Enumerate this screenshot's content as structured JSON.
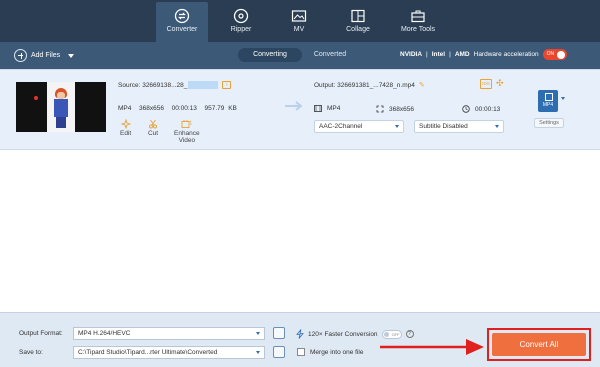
{
  "nav": {
    "items": [
      {
        "label": "Converter",
        "icon": "converter-icon",
        "active": true
      },
      {
        "label": "Ripper",
        "icon": "ripper-icon",
        "active": false
      },
      {
        "label": "MV",
        "icon": "mv-icon",
        "active": false
      },
      {
        "label": "Collage",
        "icon": "collage-icon",
        "active": false
      },
      {
        "label": "More Tools",
        "icon": "toolbox-icon",
        "active": false
      }
    ]
  },
  "toolbar": {
    "add_files": "Add Files",
    "tab_converting": "Converting",
    "tab_converted": "Converted",
    "accel_nvidia": "NVIDIA",
    "accel_intel": "Intel",
    "accel_amd": "AMD",
    "accel_label": "Hardware acceleration",
    "accel_toggle": "ON"
  },
  "file": {
    "source_label": "Source: 32669138...28_",
    "source_format": "MP4",
    "source_resolution": "368x656",
    "source_duration": "00:00:13",
    "source_size": "957.79 KB",
    "tool_edit": "Edit",
    "tool_cut": "Cut",
    "tool_enhance": "Enhance Video",
    "output_label": "Output: 326691381_...7428_n.mp4",
    "ids_badge": "IDS",
    "output_format": "MP4",
    "output_resolution": "368x656",
    "output_duration": "00:00:13",
    "audio_select": "AAC-2Channel",
    "subtitle_select": "Subtitle Disabled",
    "format_badge": "MP4",
    "settings": "Settings"
  },
  "bottom": {
    "output_format_label": "Output Format:",
    "output_format_value": "MP4 H.264/HEVC",
    "save_to_label": "Save to:",
    "save_to_value": "C:\\Tipard Studio\\Tipard...rter Ultimate\\Converted",
    "faster_label": "120× Faster Conversion",
    "faster_toggle": "OFF",
    "merge_label": "Merge into one file",
    "convert_all": "Convert All"
  },
  "colors": {
    "nav_bg": "#2a3d52",
    "toolbar_bg": "#3c5a78",
    "accent_orange": "#f06f3f",
    "highlight_red": "#e01f1f",
    "item_bg": "#e7f0fa"
  }
}
